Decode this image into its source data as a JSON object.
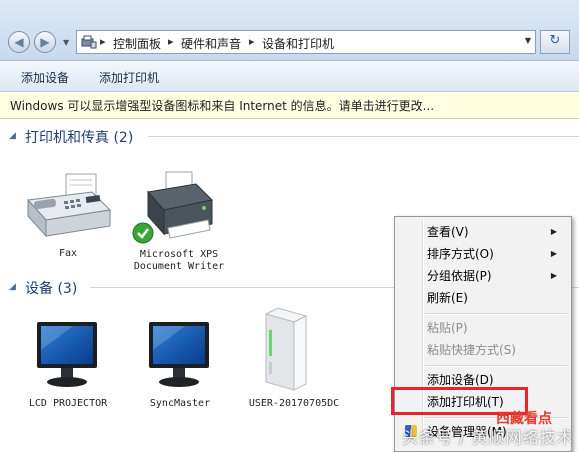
{
  "address": {
    "back_label": "◀",
    "forward_label": "▶",
    "crumbs": [
      "控制面板",
      "硬件和声音",
      "设备和打印机"
    ],
    "separator": "▸",
    "refresh_glyph": "↻"
  },
  "toolbar": {
    "add_device": "添加设备",
    "add_printer": "添加打印机"
  },
  "infobar": {
    "text": "Windows 可以显示增强型设备图标和来自 Internet 的信息。请单击进行更改..."
  },
  "groups": {
    "printers": {
      "title": "打印机和传真 (2)"
    },
    "devices": {
      "title": "设备 (3)"
    }
  },
  "printers": [
    {
      "label": "Fax",
      "icon": "fax-icon"
    },
    {
      "label_line1": "Microsoft XPS",
      "label_line2": "Document Writer",
      "icon": "printer-icon",
      "default": true
    }
  ],
  "devices": [
    {
      "label": "LCD PROJECTOR",
      "icon": "monitor-icon"
    },
    {
      "label": "SyncMaster",
      "icon": "monitor-icon"
    },
    {
      "label": "USER-20170705DC",
      "icon": "computer-tower-icon"
    }
  ],
  "context_menu": {
    "items": [
      {
        "label": "查看(V)",
        "submenu": true,
        "disabled": false
      },
      {
        "label": "排序方式(O)",
        "submenu": true,
        "disabled": false
      },
      {
        "label": "分组依据(P)",
        "submenu": true,
        "disabled": false
      },
      {
        "label": "刷新(E)",
        "submenu": false,
        "disabled": false
      },
      {
        "label": "粘贴(P)",
        "submenu": false,
        "disabled": true
      },
      {
        "label": "粘贴快捷方式(S)",
        "submenu": false,
        "disabled": true
      },
      {
        "label": "添加设备(D)",
        "submenu": false,
        "disabled": false
      },
      {
        "label": "添加打印机(T)",
        "submenu": false,
        "disabled": false
      },
      {
        "label": "设备管理器(M)",
        "submenu": false,
        "disabled": false
      }
    ],
    "submenu_arrow": "▶"
  },
  "watermark": {
    "logo_text": "西藏看点",
    "overlay_text": "头条号 / 黄顺网络技术"
  },
  "colors": {
    "highlight_box": "#e8262a",
    "group_title": "#1e3f73",
    "infobar_bg": "#ffffe1"
  }
}
